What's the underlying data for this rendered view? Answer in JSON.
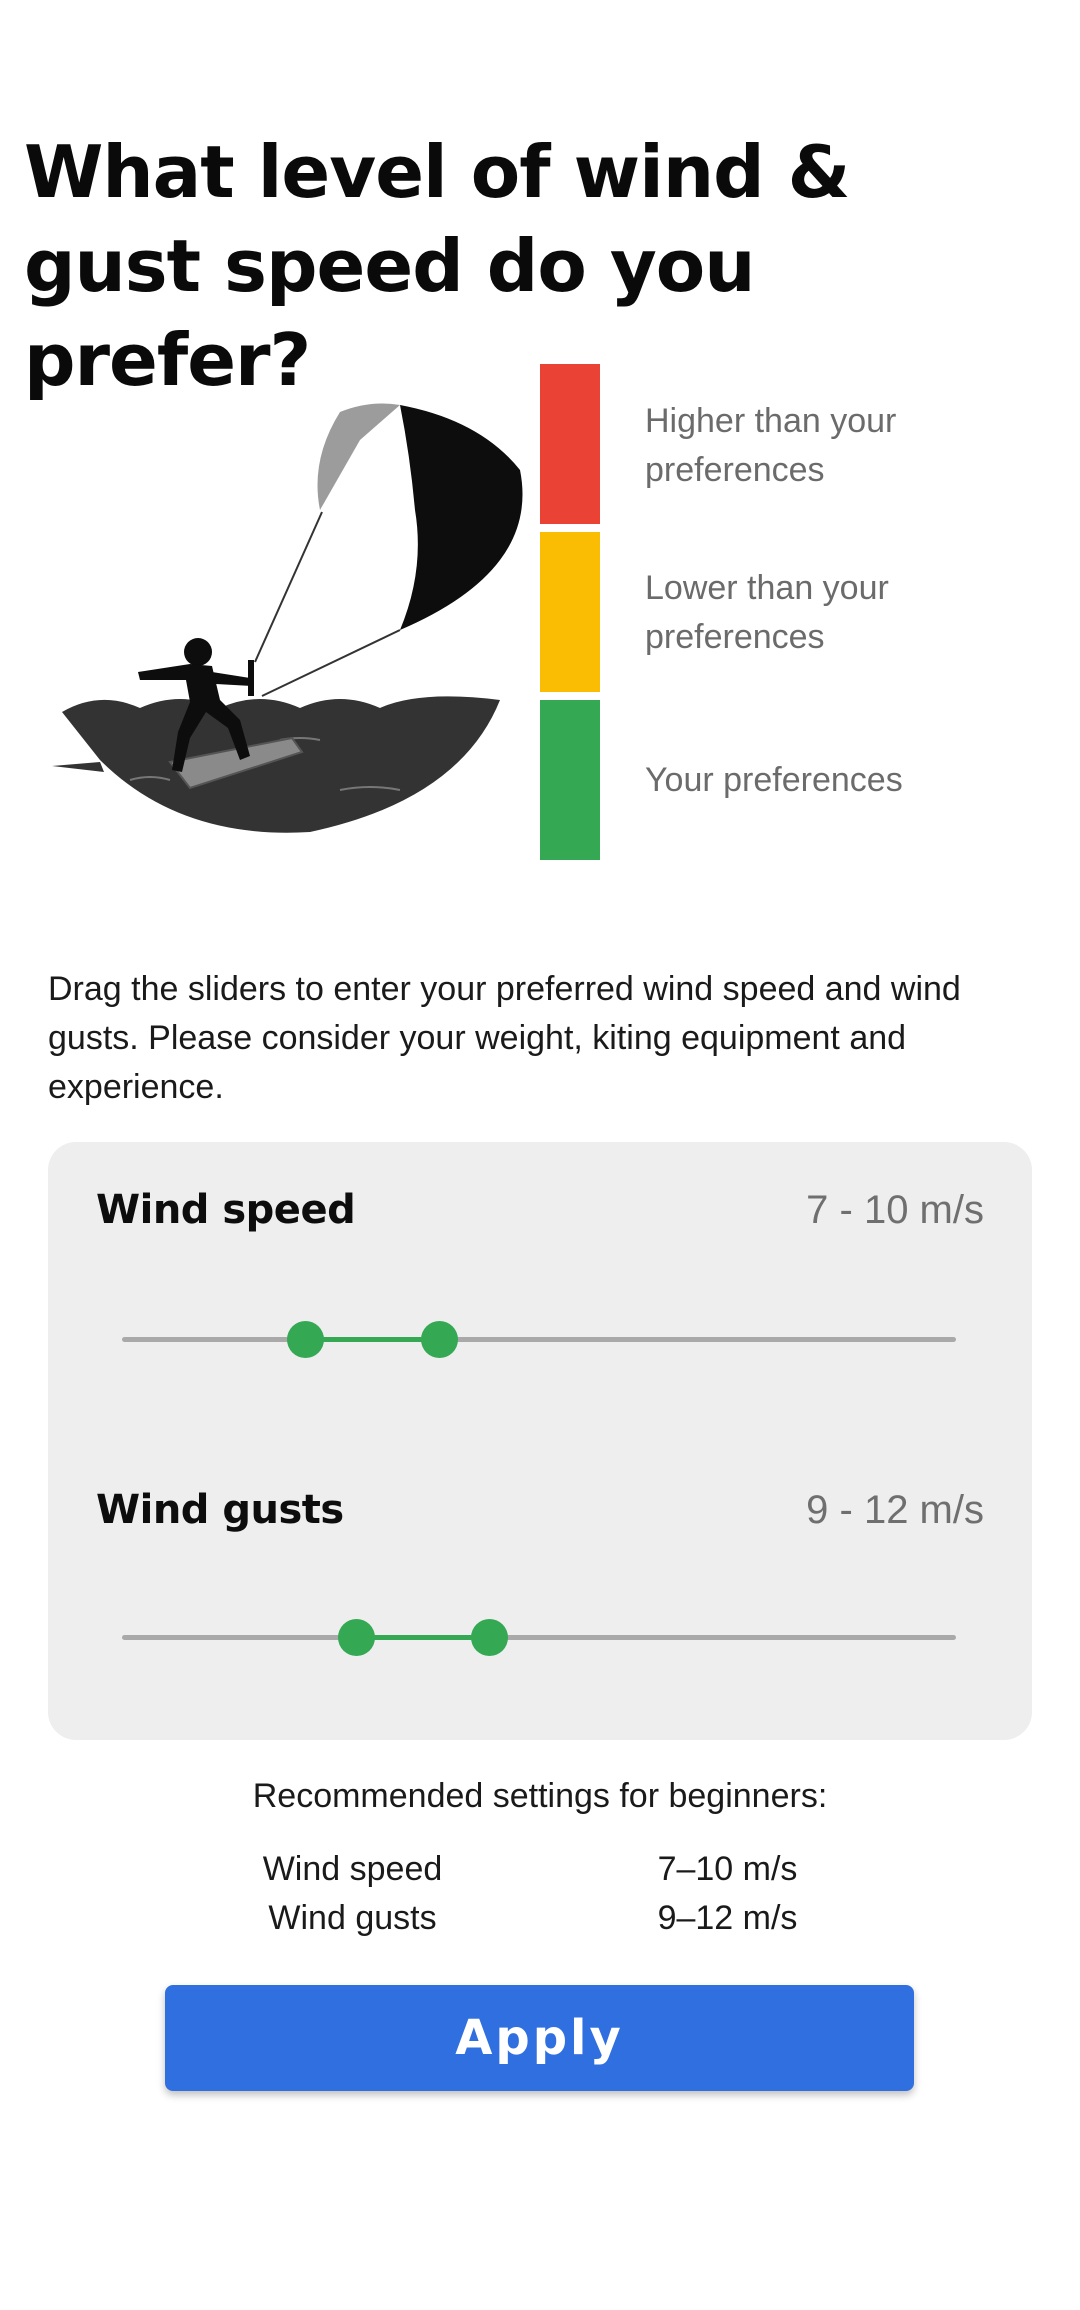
{
  "page": {
    "title": "What level of wind & gust speed do you prefer?"
  },
  "legend": {
    "items": [
      {
        "label": "Higher than your preferences",
        "color": "#ea4335"
      },
      {
        "label": "Lower than your preferences",
        "color": "#fbbc04"
      },
      {
        "label": "Your preferences",
        "color": "#34a853"
      }
    ]
  },
  "intro_text": "Drag the sliders to enter your preferred wind speed and wind gusts. Please consider your weight, kiting equipment and experience.",
  "sliders": {
    "wind_speed": {
      "label": "Wind speed",
      "value_text": "7 - 10 m/s",
      "low_fraction": 0.22,
      "high_fraction": 0.38
    },
    "wind_gusts": {
      "label": "Wind gusts",
      "value_text": "9 - 12 m/s",
      "low_fraction": 0.28,
      "high_fraction": 0.44
    }
  },
  "recommended": {
    "title": "Recommended settings for beginners:",
    "rows": [
      {
        "label": "Wind speed",
        "value": "7–10 m/s"
      },
      {
        "label": "Wind gusts",
        "value": "9–12 m/s"
      }
    ]
  },
  "apply_label": "Apply",
  "colors": {
    "accent": "#34a853",
    "button": "#2f6fe0"
  }
}
